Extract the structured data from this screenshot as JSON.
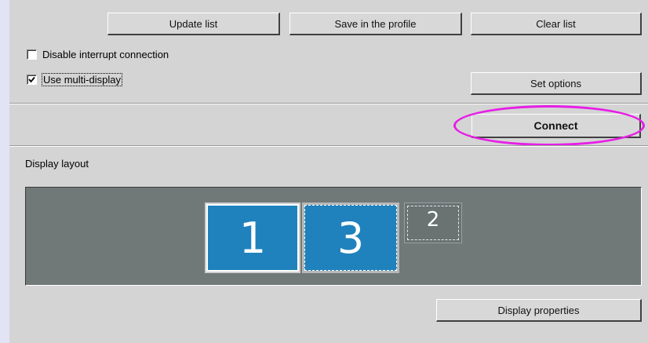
{
  "buttons": {
    "update_list": "Update list",
    "save_profile": "Save in the profile",
    "clear_list": "Clear list",
    "set_options": "Set options",
    "connect": "Connect",
    "display_properties": "Display properties"
  },
  "options": {
    "disable_interrupt": {
      "label": "Disable interrupt connection",
      "checked": false
    },
    "multi_display": {
      "label": "Use multi-display",
      "checked": true
    }
  },
  "display_layout": {
    "title": "Display layout",
    "monitors": [
      {
        "label": "1",
        "state": "selected"
      },
      {
        "label": "3",
        "state": "active"
      },
      {
        "label": "2",
        "state": "inactive"
      }
    ]
  },
  "colors": {
    "highlight": "#e61ee6",
    "monitor_blue": "#1f82bd",
    "layout_bg": "#707878"
  }
}
